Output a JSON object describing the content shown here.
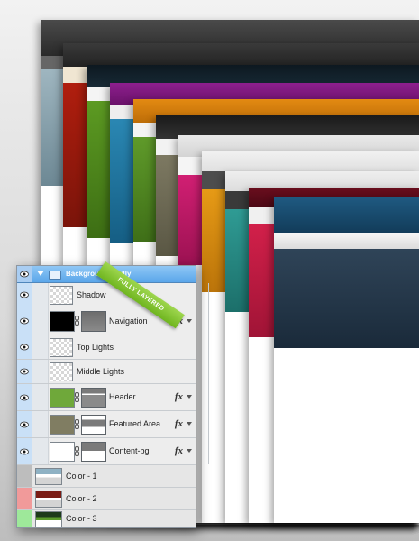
{
  "layer_group": {
    "name": "Background [ Fully",
    "badge": "FULLY LAYERED"
  },
  "layers": [
    {
      "name": "Shadow",
      "visible": true,
      "thumb": "checker",
      "fx": false
    },
    {
      "name": "Navigation",
      "visible": true,
      "thumb": "black",
      "mask": "nav-mask",
      "fx": true,
      "fx_label": "fx"
    },
    {
      "name": "Top Lights",
      "visible": true,
      "thumb": "checker",
      "fx": false
    },
    {
      "name": "Middle Lights",
      "visible": true,
      "thumb": "checker",
      "fx": false
    },
    {
      "name": "Header",
      "visible": true,
      "thumb": "#5f9a2a",
      "mask": "header-mask",
      "fx": true,
      "fx_label": "fx"
    },
    {
      "name": "Featured Area",
      "visible": true,
      "thumb": "#7b7a5e",
      "mask": "featured-mask",
      "fx": true,
      "fx_label": "fx"
    },
    {
      "name": "Content-bg",
      "visible": true,
      "thumb": "white",
      "mask": "content-mask",
      "fx": true,
      "fx_label": "fx"
    },
    {
      "name": "Color - 1",
      "visible": false,
      "toggle_color": "#bdbdbd"
    },
    {
      "name": "Color - 2",
      "visible": false,
      "toggle_color": "#f19a9a"
    },
    {
      "name": "Color - 3",
      "visible": false,
      "toggle_color": "#9ee89a"
    }
  ],
  "color_schemes": [
    "#37474f",
    "#8b1a0e",
    "#4b8a1f",
    "#1f6a8f",
    "#5e8f2a",
    "#6e6a55",
    "#c2185b",
    "#d98b12",
    "#2a8c86",
    "#c7153f",
    "#1c3c55"
  ]
}
